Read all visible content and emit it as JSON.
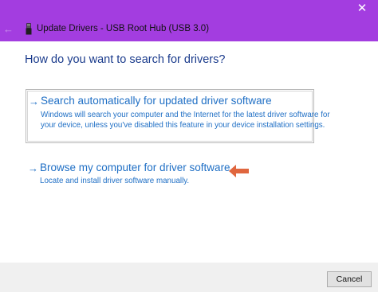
{
  "window": {
    "title": "Update Drivers - USB Root Hub (USB 3.0)",
    "close_glyph": "✕",
    "back_glyph": "←",
    "accent_color": "#a33de0"
  },
  "main": {
    "heading": "How do you want to search for drivers?",
    "options": [
      {
        "arrow": "→",
        "title": "Search automatically for updated driver software",
        "description_line1": "Windows will search your computer and the Internet for the latest driver software for",
        "description_line2": "your device, unless you've disabled this feature in your device installation settings."
      },
      {
        "arrow": "→",
        "title": "Browse my computer for driver software",
        "description_line1": "Locate and install driver software manually."
      }
    ],
    "annotation_color": "#e0663e"
  },
  "footer": {
    "cancel_label": "Cancel"
  },
  "icons": [
    "close-icon",
    "back-arrow-icon",
    "usb-device-icon",
    "arrow-right-icon",
    "red-pointer-arrow-icon"
  ]
}
